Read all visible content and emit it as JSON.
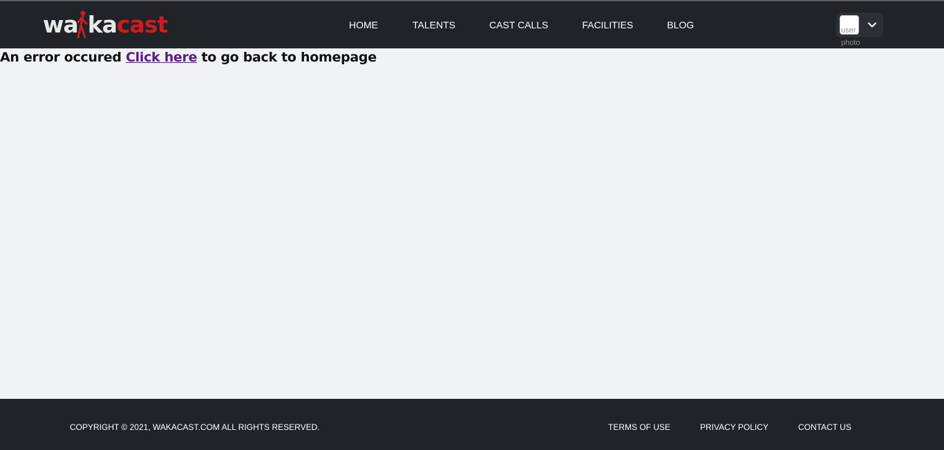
{
  "brand": {
    "logo_part1": "wa",
    "logo_part2": "ka",
    "logo_part3": "cast",
    "accent_color": "#c81e24",
    "header_bg": "#202328"
  },
  "nav": {
    "items": [
      {
        "label": "HOME"
      },
      {
        "label": "TALENTS"
      },
      {
        "label": "CAST CALLS"
      },
      {
        "label": "FACILITIES"
      },
      {
        "label": "BLOG"
      }
    ]
  },
  "user_menu": {
    "avatar_alt": "user photo",
    "avatar_alt_line1": "user",
    "avatar_alt_line2": "photo",
    "dropdown_icon": "chevron-down-icon"
  },
  "main": {
    "error_prefix": "An error occured",
    "link_text": "Click here",
    "error_suffix": "to go back to homepage"
  },
  "footer": {
    "copyright": "COPYRIGHT © 2021, WAKACAST.COM ALL RIGHTS RESERVED.",
    "links": [
      {
        "label": "TERMS OF USE"
      },
      {
        "label": "PRIVACY POLICY"
      },
      {
        "label": "CONTACT US"
      }
    ]
  }
}
